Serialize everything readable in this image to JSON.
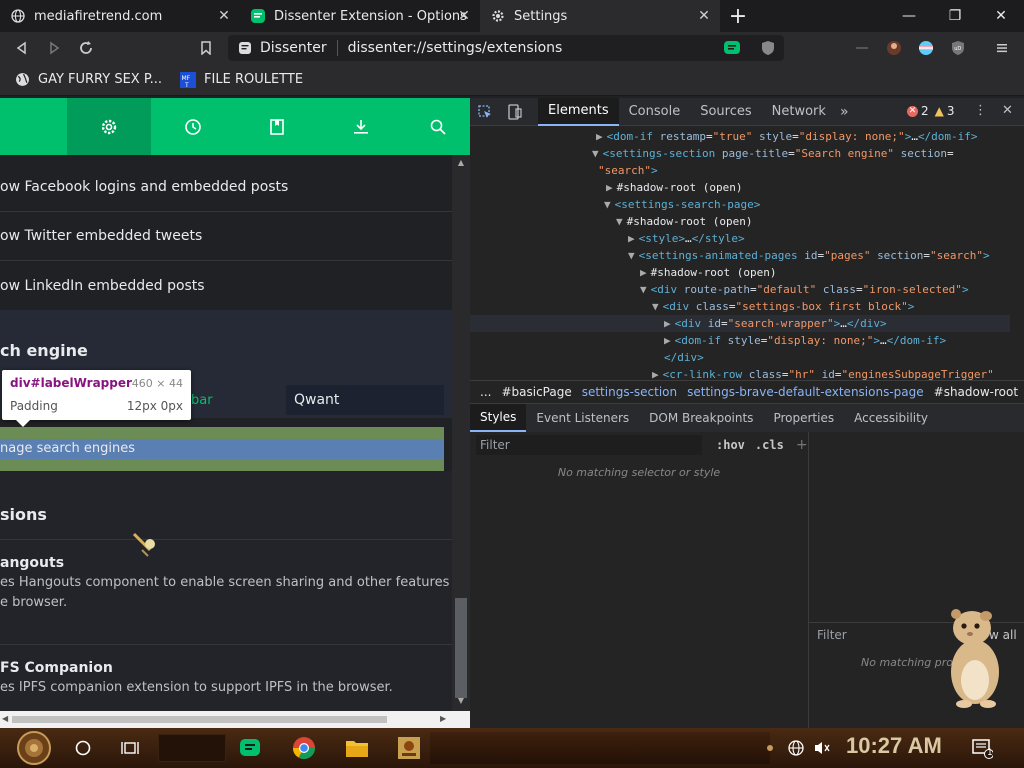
{
  "tabs": [
    {
      "title": "mediafiretrend.com",
      "icon": "globe-icon"
    },
    {
      "title": "Dissenter Extension - Options",
      "icon": "dissenter-icon"
    },
    {
      "title": "Settings",
      "icon": "gear-icon"
    }
  ],
  "toolbar": {
    "chip": "Dissenter",
    "url": "dissenter://settings/extensions"
  },
  "bookmarks": [
    {
      "label": "GAY FURRY SEX P...",
      "icon": "globe-icon"
    },
    {
      "label": "FILE ROULETTE",
      "icon": "mf-icon"
    }
  ],
  "settings": {
    "rows": [
      "ow Facebook logins and embedded posts",
      "ow Twitter embedded tweets",
      "ow LinkedIn embedded posts"
    ],
    "search_section": "ch engine",
    "search_row_left": "bar",
    "search_row_value": "Qwant",
    "manage_label": "nage search engines",
    "extensions_section": "sions",
    "hangouts_title": "angouts",
    "hangouts_desc_1": "es Hangouts component to enable screen sharing and other features in",
    "hangouts_desc_2": "e browser.",
    "ipfs_title": "FS Companion",
    "ipfs_desc": "es IPFS companion extension to support IPFS in the browser."
  },
  "tooltip": {
    "selector": "div#labelWrapper",
    "size": "460 × 44",
    "prop": "Padding",
    "prop_value": "12px 0px"
  },
  "devtools": {
    "tabs": [
      "Elements",
      "Console",
      "Sources",
      "Network"
    ],
    "errors": "2",
    "warnings": "3",
    "breadcrumbs": [
      "...",
      "#basicPage",
      "settings-section",
      "settings-brave-default-extensions-page",
      "#shadow-root"
    ],
    "style_tabs": [
      "Styles",
      "Event Listeners",
      "DOM Breakpoints",
      "Properties",
      "Accessibility"
    ],
    "filter_placeholder": "Filter",
    "hov": ":hov",
    "cls": ".cls",
    "no_match": "No matching selector or style",
    "side_filter": "Filter",
    "side_show_all": "w all",
    "side_no_match": "No matching pro"
  },
  "taskbar": {
    "clock": "10:27 AM",
    "notif_count": "1"
  },
  "colors": {
    "accent_green": "#00c06d",
    "devtools_tag": "#5db0d7",
    "devtools_value": "#f29766"
  }
}
